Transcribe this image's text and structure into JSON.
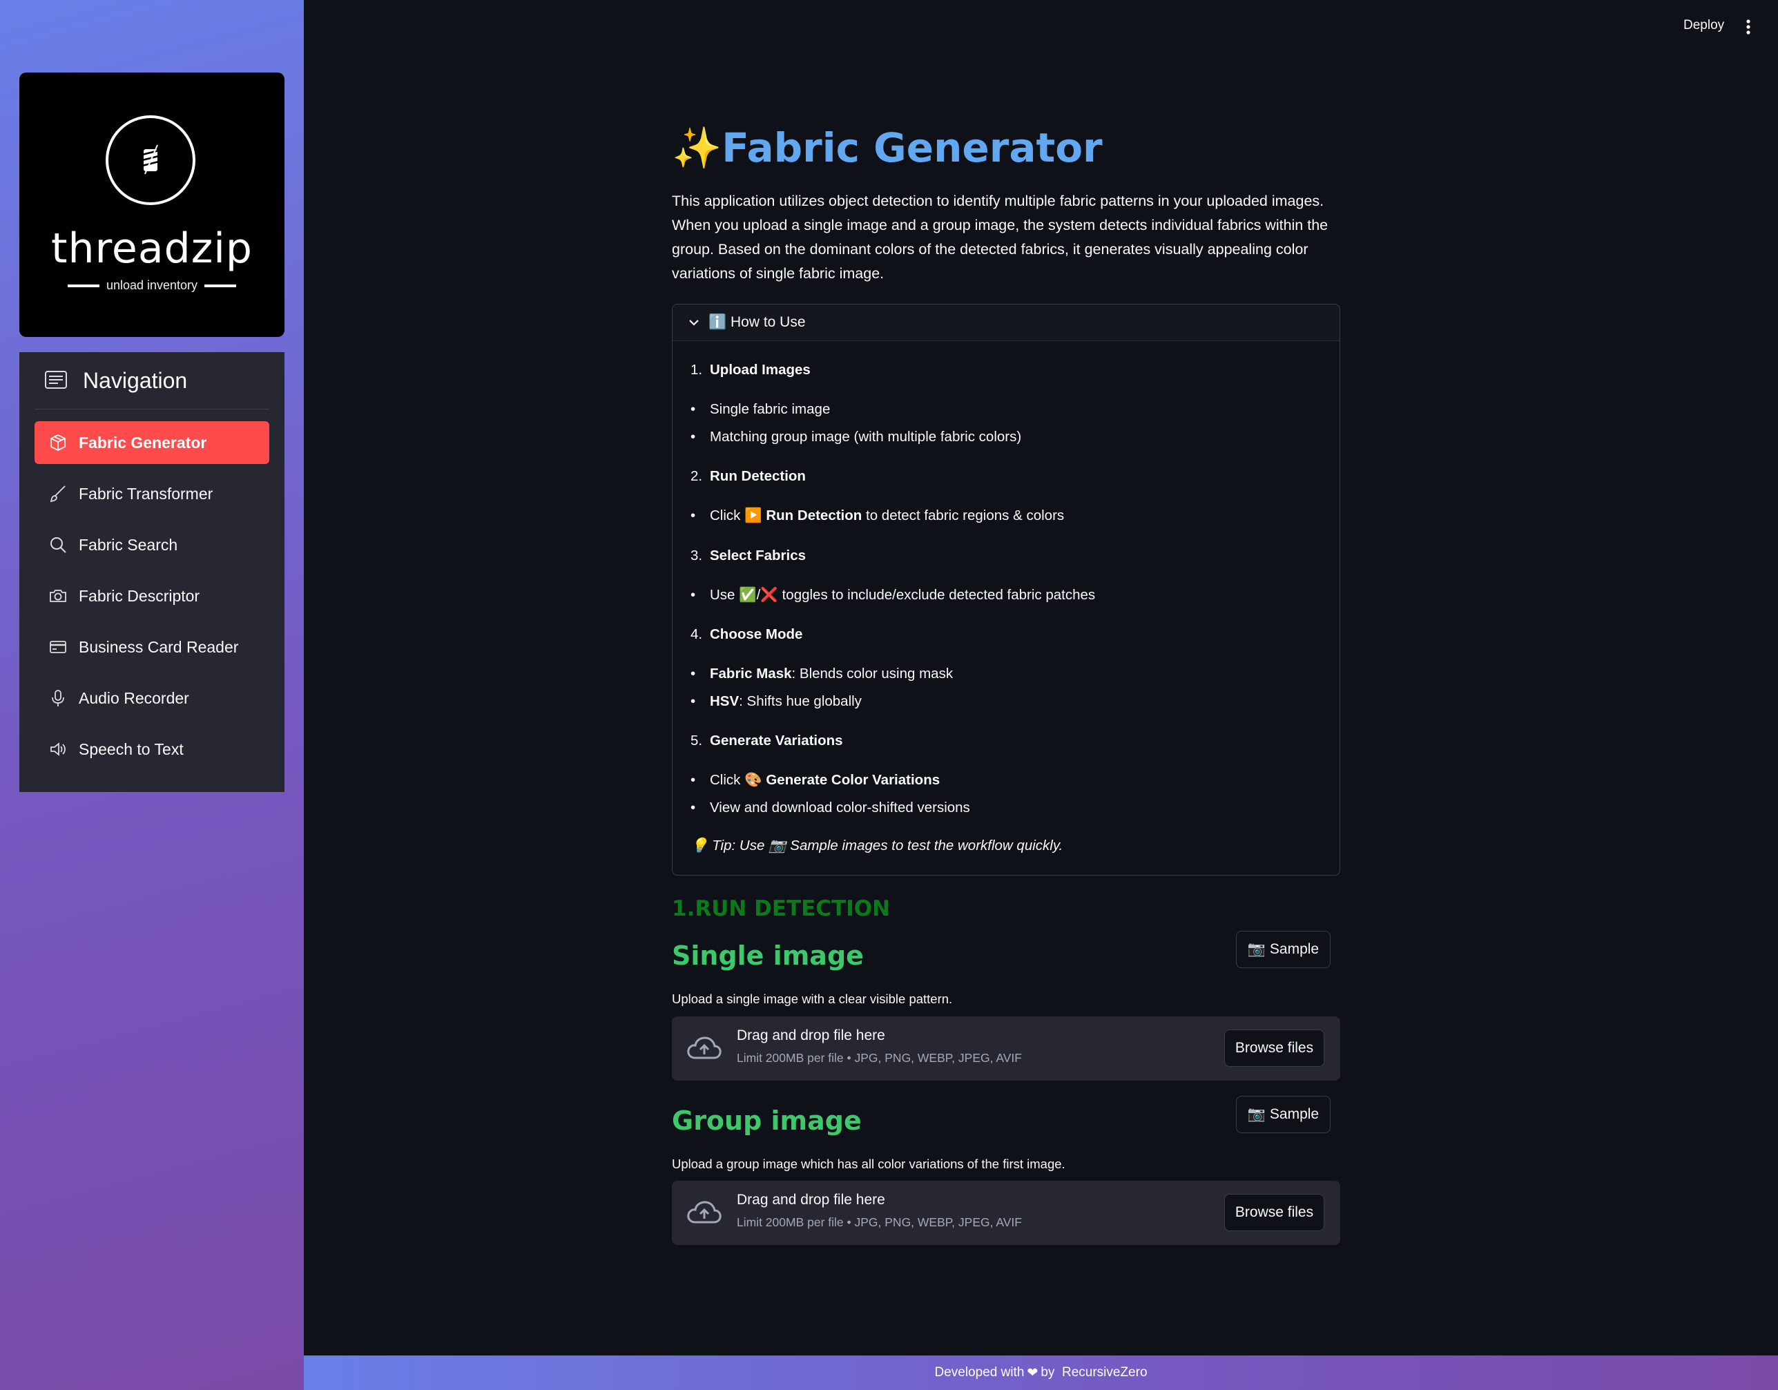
{
  "sidebar": {
    "logo": {
      "name": "threadzip",
      "tagline": "unload inventory"
    },
    "nav_title": "Navigation",
    "items": [
      {
        "label": "Fabric Generator",
        "icon": "box-icon",
        "active": true
      },
      {
        "label": "Fabric Transformer",
        "icon": "brush-icon"
      },
      {
        "label": "Fabric Search",
        "icon": "search-icon"
      },
      {
        "label": "Fabric Descriptor",
        "icon": "camera-icon"
      },
      {
        "label": "Business Card Reader",
        "icon": "credit-card-icon"
      },
      {
        "label": "Audio Recorder",
        "icon": "microphone-icon"
      },
      {
        "label": "Speech to Text",
        "icon": "speaker-icon"
      }
    ]
  },
  "header": {
    "deploy_label": "Deploy"
  },
  "main": {
    "title_emoji": "✨",
    "title": "Fabric Generator",
    "intro": "This application utilizes object detection to identify multiple fabric patterns in your uploaded images. When you upload a single image and a group image, the system detects individual fabrics within the group. Based on the dominant colors of the detected fabrics, it generates visually appealing color variations of single fabric image.",
    "how_to": {
      "label": "ℹ️ How to Use",
      "steps": [
        {
          "n": "1.",
          "title": "Upload Images"
        },
        {
          "n": "2.",
          "title": "Run Detection"
        },
        {
          "n": "3.",
          "title": "Select Fabrics"
        },
        {
          "n": "4.",
          "title": "Choose Mode"
        },
        {
          "n": "5.",
          "title": "Generate Variations"
        }
      ],
      "bullets": {
        "b1": "Single fabric image",
        "b2": "Matching group image (with multiple fabric colors)",
        "b3_pre": "Click ▶️",
        "b3_bold": "Run Detection",
        "b3_post": "to detect fabric regions & colors",
        "b4": "Use ✅/❌ toggles to include/exclude detected fabric patches",
        "b5_bold": "Fabric Mask",
        "b5_post": ": Blends color using mask",
        "b6_bold": "HSV",
        "b6_post": ": Shifts hue globally",
        "b7_pre": "Click 🎨",
        "b7_bold": "Generate Color Variations",
        "b8": "View and download color-shifted versions"
      },
      "tip": "💡 Tip: Use 📷 Sample images to test the workflow quickly."
    },
    "run_detection_heading": "1.RUN DETECTION",
    "single": {
      "title": "Single image",
      "sample_label": "📷 Sample",
      "caption": "Upload a single image with a clear visible pattern.",
      "dz_title": "Drag and drop file here",
      "dz_limit": "Limit 200MB per file • JPG, PNG, WEBP, JPEG, AVIF",
      "browse_label": "Browse files"
    },
    "group": {
      "title": "Group image",
      "sample_label": "📷 Sample",
      "caption": "Upload a group image which has all color variations of the first image.",
      "dz_title": "Drag and drop file here",
      "dz_limit": "Limit 200MB per file • JPG, PNG, WEBP, JPEG, AVIF",
      "browse_label": "Browse files"
    }
  },
  "footer": {
    "pre": "Developed with",
    "heart": "❤",
    "by": "by",
    "author": "RecursiveZero"
  },
  "colors": {
    "accent": "#ff4b4b",
    "title_blue": "#62a8f0",
    "section_green": "#3dc86b",
    "run_green": "#0b7a1a"
  }
}
